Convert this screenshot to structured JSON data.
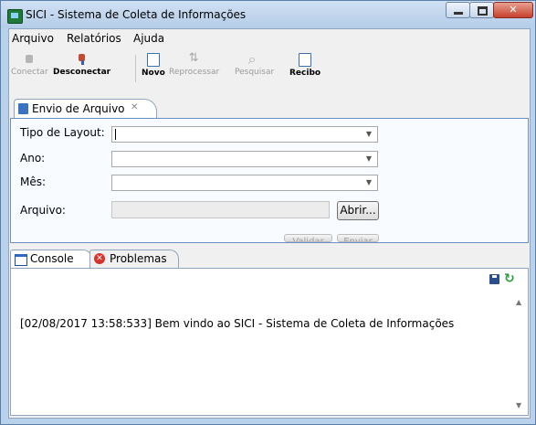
{
  "window": {
    "title": "SICI - Sistema de Coleta de Informações"
  },
  "menu": [
    "Arquivo",
    "Relatórios",
    "Ajuda"
  ],
  "toolbar": [
    {
      "label": "Conectar",
      "icon": "connect-icon",
      "enabled": false
    },
    {
      "label": "Desconectar",
      "icon": "disconnect-icon",
      "enabled": true
    },
    {
      "label": "Novo",
      "icon": "new-document-icon",
      "enabled": true
    },
    {
      "label": "Reprocessar",
      "icon": "reprocess-icon",
      "enabled": false
    },
    {
      "label": "Pesquisar",
      "icon": "search-icon",
      "enabled": false
    },
    {
      "label": "Recibo",
      "icon": "receipt-icon",
      "enabled": true
    }
  ],
  "editor_tab": {
    "label": "Envio de Arquivo",
    "close": "✕"
  },
  "form": {
    "layout_label": "Tipo de Layout:",
    "ano_label": "Ano:",
    "mes_label": "Mês:",
    "arquivo_label": "Arquivo:",
    "layout_value": "",
    "ano_value": "",
    "mes_value": "",
    "arquivo_value": "",
    "abrir_label": "Abrir...",
    "validar_label": "Validar",
    "enviar_label": "Enviar"
  },
  "bottom_tabs": [
    {
      "label": "Console",
      "active": true
    },
    {
      "label": "Problemas",
      "active": false
    }
  ],
  "console": {
    "message": "[02/08/2017 13:58:533] Bem vindo ao SICI - Sistema de Coleta de Informações"
  },
  "colors": {
    "accent": "#6b8fc2",
    "title_bg": "#b9d1ea",
    "close_button": "#c6402c"
  }
}
